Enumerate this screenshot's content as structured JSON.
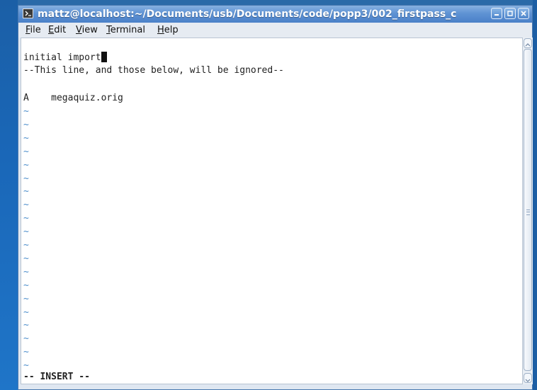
{
  "window": {
    "title": "mattz@localhost:~/Documents/usb/Documents/code/popp3/002_firstpass_c"
  },
  "menu": {
    "file": {
      "prefix": "",
      "mnemonic": "F",
      "rest": "ile"
    },
    "edit": {
      "prefix": "",
      "mnemonic": "E",
      "rest": "dit"
    },
    "view": {
      "prefix": "",
      "mnemonic": "V",
      "rest": "iew"
    },
    "terminal": {
      "prefix": "",
      "mnemonic": "T",
      "rest": "erminal"
    },
    "help": {
      "prefix": "",
      "mnemonic": "H",
      "rest": "elp"
    }
  },
  "editor": {
    "line1": "initial import",
    "line2": "--This line, and those below, will be ignored--",
    "line3": "",
    "line4": "A    megaquiz.orig",
    "tilde": "~",
    "mode": "-- INSERT --"
  },
  "colors": {
    "titlebar": "#5f93d4",
    "tilde": "#4e8fcc",
    "background": "#ffffff"
  },
  "icons": {
    "app": "terminal-icon",
    "minimize": "minimize-icon",
    "maximize": "maximize-icon",
    "close": "close-icon",
    "scroll_up": "chevron-up-icon",
    "scroll_down": "chevron-down-icon"
  }
}
